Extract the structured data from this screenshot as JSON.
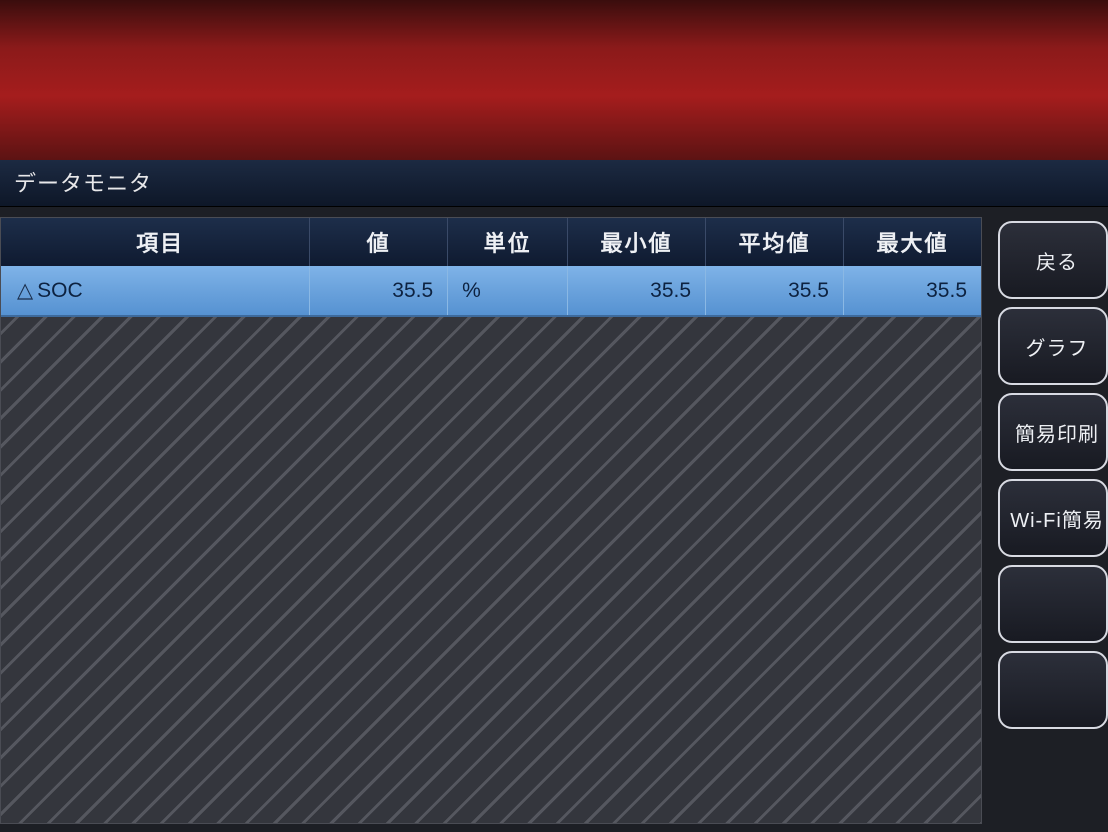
{
  "title": "データモニタ",
  "table": {
    "headers": {
      "item": "項目",
      "value": "値",
      "unit": "単位",
      "min": "最小値",
      "avg": "平均値",
      "max": "最大値"
    },
    "rows": [
      {
        "icon": "△",
        "item": "SOC",
        "value": "35.5",
        "unit": "%",
        "min": "35.5",
        "avg": "35.5",
        "max": "35.5"
      }
    ]
  },
  "side": {
    "back": "戻る",
    "graph": "グラフ",
    "simple_print": "簡易印刷",
    "wifi_simple": "Wi-Fi簡易",
    "empty1": "",
    "empty2": ""
  }
}
